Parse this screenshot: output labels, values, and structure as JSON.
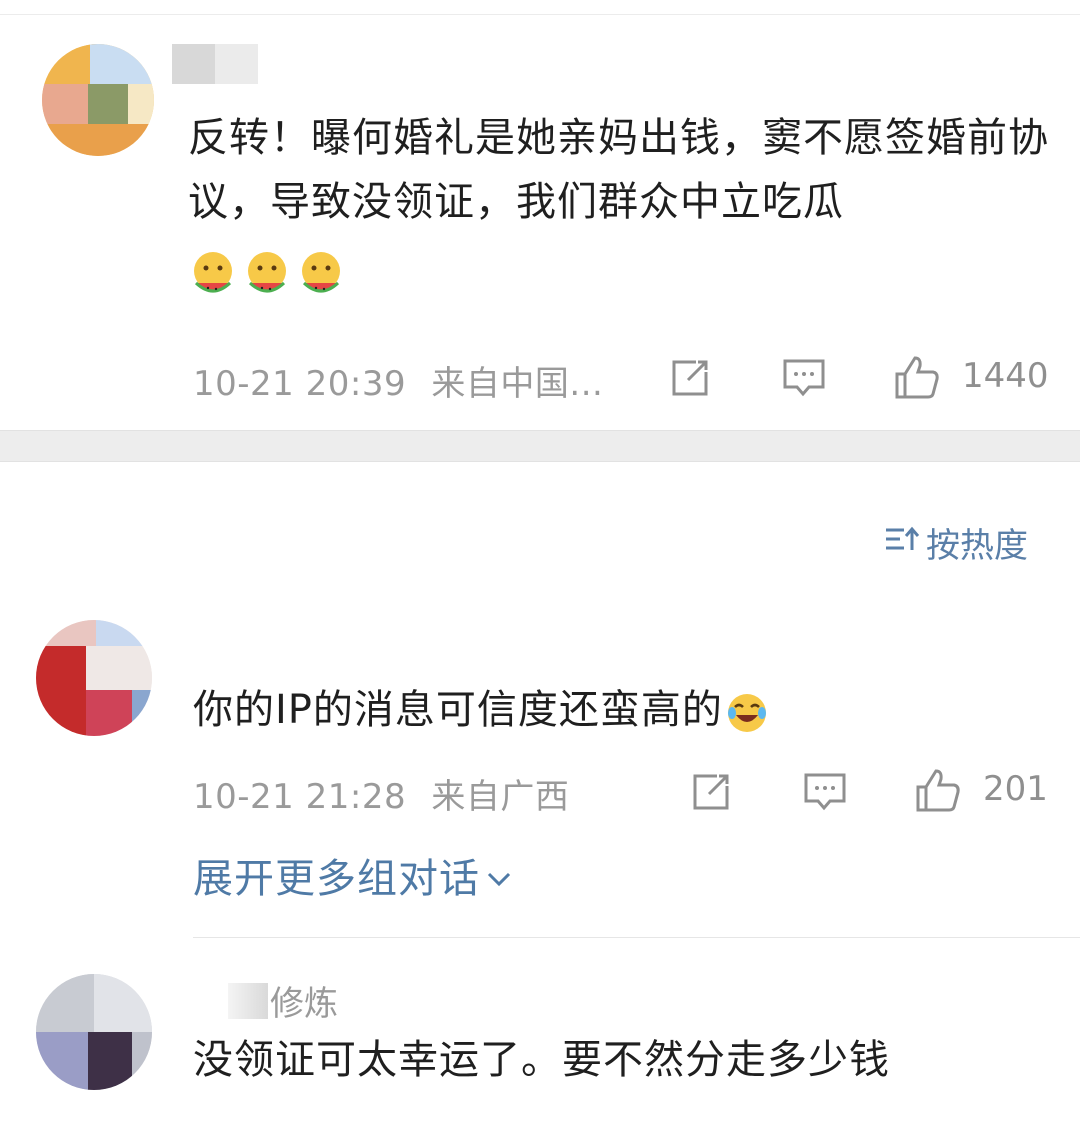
{
  "comments": [
    {
      "text": "反转！曝何婚礼是她亲妈出钱，窦不愿签婚前协议，导致没领证，我们群众中立吃瓜",
      "emoji_count": 3,
      "emoji_icon": "watermelon-eating-emoji",
      "time": "10-21 20:39",
      "source": "来自中国...",
      "likes": "1440"
    },
    {
      "text": "你的IP的消息可信度还蛮高的",
      "emoji_icon": "laugh-cry-emoji",
      "time": "10-21 21:28",
      "source": "来自广西",
      "likes": "201"
    },
    {
      "name_partial": "修炼",
      "text": "没领证可太幸运了。要不然分走多少钱"
    }
  ],
  "sort": {
    "label": "按热度",
    "icon": "sort-icon"
  },
  "expand": {
    "label": "展开更多组对话"
  },
  "colors": {
    "link": "#4f7aa6",
    "meta": "#9a9a9a",
    "separator": "#ededed"
  }
}
